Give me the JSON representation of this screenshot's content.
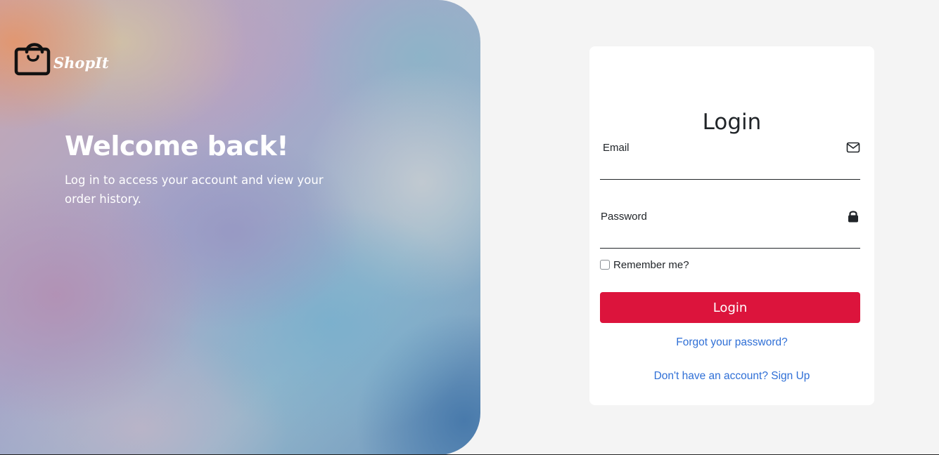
{
  "brand": {
    "logo_text": "ShopIt"
  },
  "hero": {
    "title": "Welcome back!",
    "subtitle": "Log in to access your account and view your order history."
  },
  "login_form": {
    "title": "Login",
    "email_label": "Email",
    "email_value": "",
    "password_label": "Password",
    "password_value": "",
    "remember_label": "Remember me?",
    "remember_checked": false,
    "submit_label": "Login",
    "forgot_link": "Forgot your password?",
    "signup_link": "Don't have an account? Sign Up"
  },
  "icons": {
    "logo": "shopping-bag-icon",
    "email": "envelope-icon",
    "password": "lock-icon"
  },
  "colors": {
    "accent": "#dc143c",
    "link": "#2f6fd6",
    "background": "#f4f4f4",
    "card": "#ffffff"
  }
}
